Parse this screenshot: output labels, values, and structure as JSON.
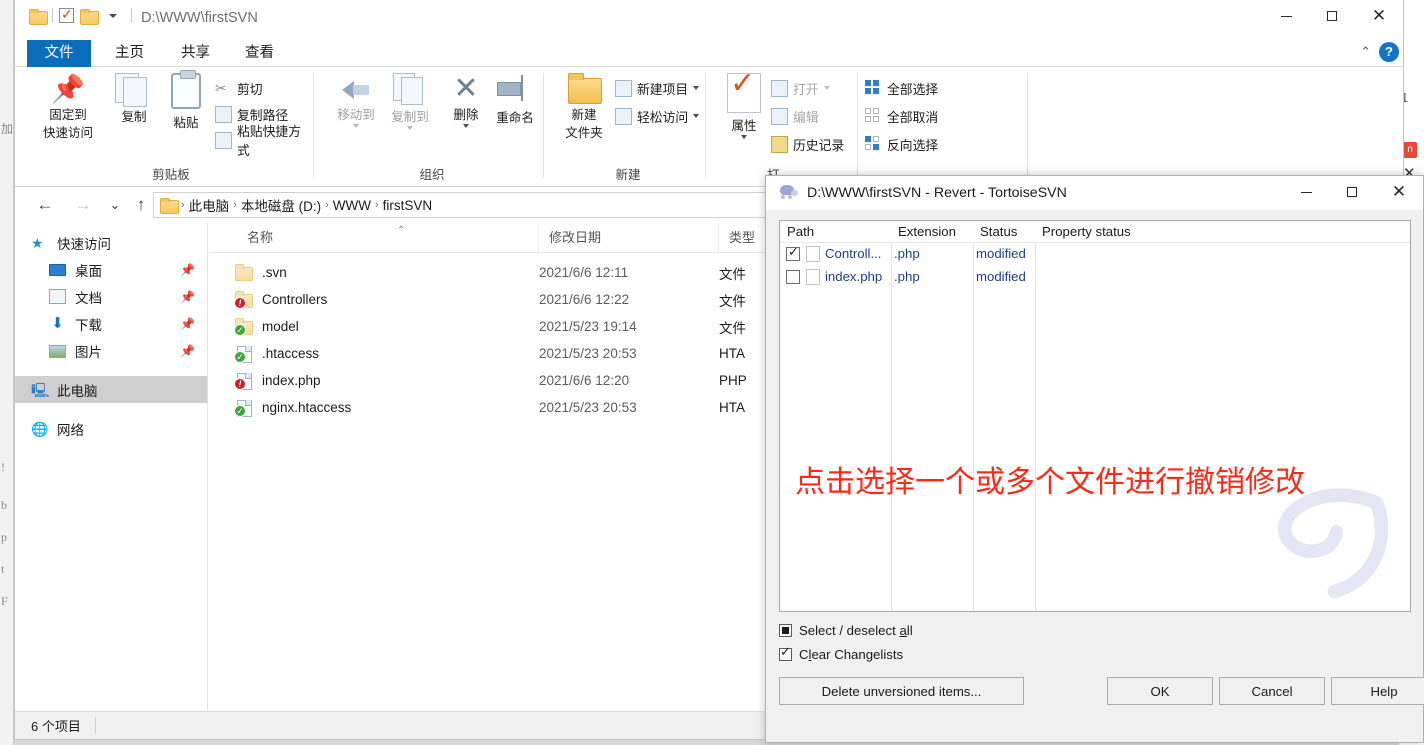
{
  "explorer": {
    "window_path": "D:\\WWW\\firstSVN",
    "quick_access_icons": [
      "folder-icon",
      "checkbox-check-icon",
      "folder-icon",
      "chevron-down-icon"
    ],
    "window_buttons": {
      "minimize": "—",
      "maximize": "□",
      "close": "✕"
    },
    "help_label": "?",
    "tabs": [
      {
        "label": "文件",
        "active": true
      },
      {
        "label": "主页",
        "active": false
      },
      {
        "label": "共享",
        "active": false
      },
      {
        "label": "查看",
        "active": false
      }
    ],
    "ribbon": {
      "groups": [
        {
          "name": "剪贴板"
        },
        {
          "name": "组织"
        },
        {
          "name": "新建"
        },
        {
          "name": "打"
        }
      ],
      "clipboard": {
        "pin": "固定到\n快速访问",
        "pin_l1": "固定到",
        "pin_l2": "快速访问",
        "copy": "复制",
        "paste": "粘贴",
        "cut": "剪切",
        "copy_path": "复制路径",
        "paste_shortcut": "粘贴快捷方式"
      },
      "organize": {
        "move_to": "移动到",
        "copy_to": "复制到",
        "delete": "删除",
        "rename": "重命名"
      },
      "new": {
        "new_folder_l1": "新建",
        "new_folder_l2": "文件夹",
        "new_item": "新建项目",
        "easy_access": "轻松访问"
      },
      "open": {
        "properties": "属性",
        "open": "打开",
        "edit": "编辑",
        "history": "历史记录"
      },
      "select": {
        "select_all": "全部选择",
        "select_none": "全部取消",
        "invert": "反向选择"
      }
    },
    "address": {
      "back": "←",
      "forward": "→",
      "recent": "⌄",
      "up": "↑",
      "crumbs": [
        "此电脑",
        "本地磁盘 (D:)",
        "WWW",
        "firstSVN"
      ],
      "separator": "›"
    },
    "nav_pane": [
      {
        "label": "快速访问",
        "icon": "star-icon",
        "indent": false,
        "pinned": false,
        "selected": false
      },
      {
        "label": "桌面",
        "icon": "desktop-icon",
        "indent": true,
        "pinned": true,
        "selected": false
      },
      {
        "label": "文档",
        "icon": "documents-icon",
        "indent": true,
        "pinned": true,
        "selected": false
      },
      {
        "label": "下载",
        "icon": "download-icon",
        "indent": true,
        "pinned": true,
        "selected": false
      },
      {
        "label": "图片",
        "icon": "pictures-icon",
        "indent": true,
        "pinned": true,
        "selected": false
      },
      {
        "label": "此电脑",
        "icon": "this-pc-icon",
        "indent": false,
        "pinned": false,
        "selected": true
      },
      {
        "label": "网络",
        "icon": "network-icon",
        "indent": false,
        "pinned": false,
        "selected": false
      }
    ],
    "columns": [
      {
        "label": "名称",
        "sorted": true
      },
      {
        "label": "修改日期",
        "sorted": false
      },
      {
        "label": "类型",
        "sorted": false
      }
    ],
    "files": [
      {
        "name": ".svn",
        "date": "2021/6/6 12:11",
        "type": "文件",
        "icon": "folder-icon",
        "overlay": "none"
      },
      {
        "name": "Controllers",
        "date": "2021/6/6 12:22",
        "type": "文件",
        "icon": "folder-icon",
        "overlay": "red"
      },
      {
        "name": "model",
        "date": "2021/5/23 19:14",
        "type": "文件",
        "icon": "folder-icon",
        "overlay": "green"
      },
      {
        "name": ".htaccess",
        "date": "2021/5/23 20:53",
        "type": "HTA",
        "icon": "file-icon",
        "overlay": "green"
      },
      {
        "name": "index.php",
        "date": "2021/6/6 12:20",
        "type": "PHP",
        "icon": "file-icon",
        "overlay": "red"
      },
      {
        "name": "nginx.htaccess",
        "date": "2021/5/23 20:53",
        "type": "HTA",
        "icon": "file-icon",
        "overlay": "green"
      }
    ],
    "status": "6 个项目"
  },
  "svn_dialog": {
    "title": "D:\\WWW\\firstSVN - Revert - TortoiseSVN",
    "window_buttons": {
      "minimize": "—",
      "maximize": "□",
      "close": "✕"
    },
    "columns": [
      "Path",
      "Extension",
      "Status",
      "Property status"
    ],
    "rows": [
      {
        "checked": true,
        "path": "Controll...",
        "extension": ".php",
        "status": "modified",
        "property_status": ""
      },
      {
        "checked": false,
        "path": "index.php",
        "extension": ".php",
        "status": "modified",
        "property_status": ""
      }
    ],
    "annotation": "点击选择一个或多个文件进行撤销修改",
    "annotation_color": "#fb2a18",
    "select_deselect_all": {
      "label_pre": "Select / deselect ",
      "label_accel": "a",
      "label_post": "ll",
      "state": "indeterminate"
    },
    "clear_changelists": {
      "label_pre": "C",
      "label_accel": "l",
      "label_post": "ear Changelists",
      "state": "checked"
    },
    "buttons": {
      "delete_unversioned_pre": "D",
      "delete_unversioned_accel": "",
      "delete_unversioned": "Delete unversioned items...",
      "ok": "OK",
      "cancel": "Cancel",
      "help": "Help"
    }
  },
  "background": {
    "left_fragments": [
      "加",
      "!",
      "b",
      "p",
      "t",
      "F"
    ],
    "right_fragments": [
      "1",
      "n"
    ]
  }
}
